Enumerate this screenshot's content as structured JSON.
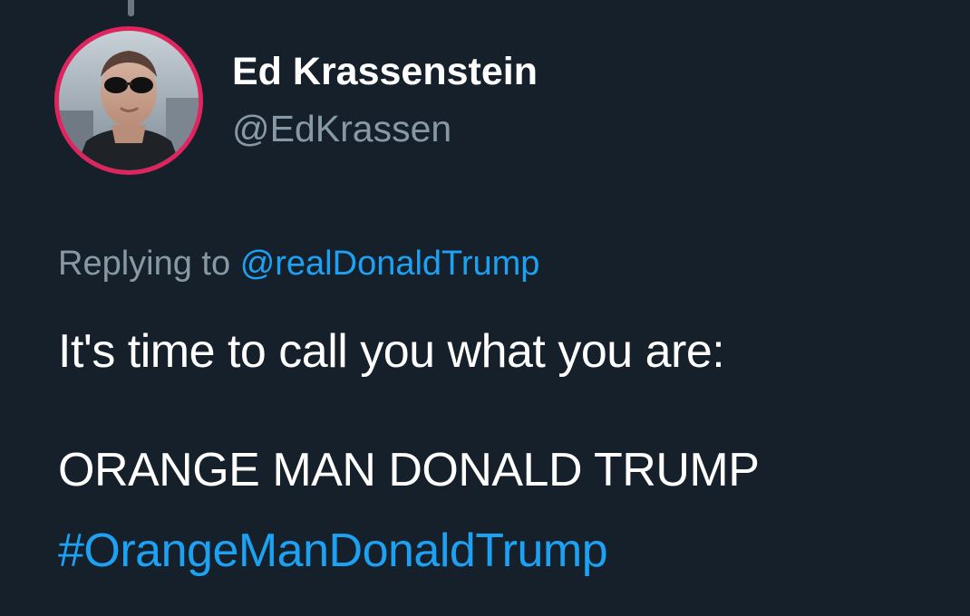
{
  "tweet": {
    "author": {
      "display_name": "Ed Krassenstein",
      "handle": "@EdKrassen"
    },
    "reply": {
      "prefix": "Replying to",
      "target": "@realDonaldTrump"
    },
    "text_lines": [
      "It's time to call you what you are:",
      "ORANGE MAN DONALD TRUMP"
    ],
    "hashtag": "#OrangeManDonaldTrump"
  },
  "colors": {
    "background": "#15202b",
    "primary_text": "#ffffff",
    "secondary_text": "#8899a6",
    "accent": "#1da1f2",
    "avatar_ring": "#e0245e",
    "thread_line": "#6b7682"
  },
  "icons": {
    "avatar": "profile-photo"
  }
}
